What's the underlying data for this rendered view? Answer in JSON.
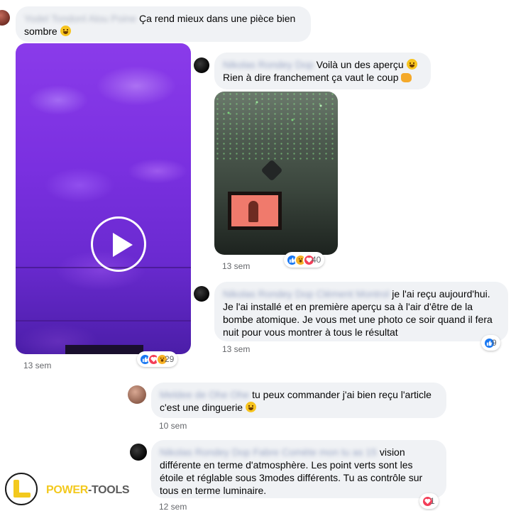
{
  "comments": [
    {
      "name": "Yodel Tondonl Alou Poine",
      "text": "Ça rend mieux dans une pièce bien sombre",
      "emoji": "grinning-sweat-emoji",
      "time": "13 sem",
      "reactions": {
        "icons": [
          "like",
          "love",
          "wow"
        ],
        "count": "29"
      }
    },
    {
      "name": "Nikolas Rondey Dop",
      "line1": "Voilà un des aperçu",
      "emoji1": "smiling-emoji",
      "line2": "Rien à dire franchement ça vaut le coup",
      "emoji2": "fist-emoji",
      "time": "13 sem",
      "reactions": {
        "icons": [
          "like",
          "wow",
          "love"
        ],
        "count": "40"
      }
    },
    {
      "name": "Nikolas Rondey Dop Clément Montrol",
      "text": "je l'ai reçu aujourd'hui. Je l'ai installé et en première aperçu sa à l'air d'être de la bombe atomique. Je vous met une photo ce soir quand il fera nuit pour vous montrer à tous le résultat",
      "time": "13 sem",
      "reactions": {
        "icons": [
          "like"
        ],
        "count": "9"
      }
    },
    {
      "name": "Meldee de Ohe Ohe",
      "text": "tu peux commander j'ai bien reçu l'article c'est une dinguerie",
      "emoji": "smiling-emoji",
      "time": "10 sem"
    },
    {
      "name": "Nikolas Rondey Dop Fabre Comète mon tu as 15",
      "text": "vision différente en terme d'atmosphère. Les point verts sont les étoile et réglable sous 3modes différents. Tu as contrôle sur tous en terme luminaire.",
      "time": "12 sem",
      "reactions": {
        "icons": [
          "love"
        ],
        "count": "1"
      }
    }
  ],
  "watermark": {
    "part1": "POWER",
    "part2": "-TOOLS"
  },
  "colors": {
    "like": "#1877f2",
    "love": "#f33e58",
    "wow": "#f7b125",
    "bubble": "#f0f2f5",
    "brand_yellow": "#f3c91e"
  }
}
